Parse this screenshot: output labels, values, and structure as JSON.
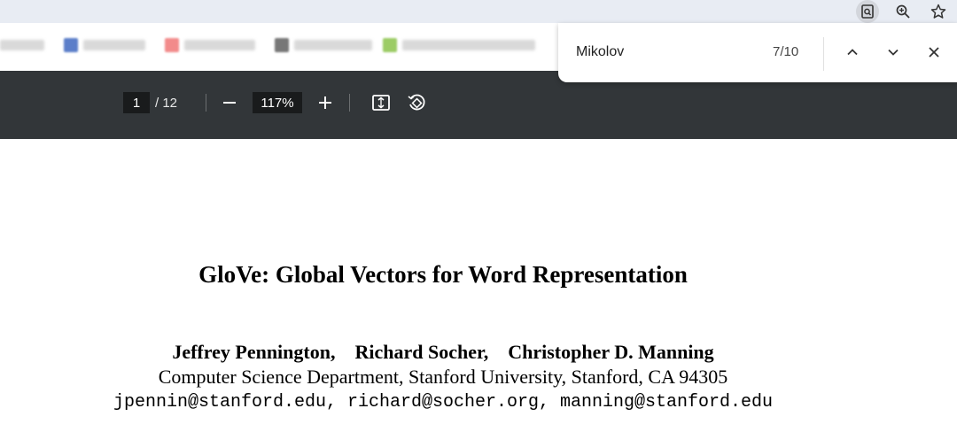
{
  "browser": {
    "icons": [
      "page-search-icon",
      "zoom-icon",
      "star-icon"
    ]
  },
  "bookmarks": [
    {
      "color": "#5b7ec9"
    },
    {
      "color": "#f28b8b"
    },
    {
      "color": "#777777"
    },
    {
      "color": "#9ccc65"
    }
  ],
  "find": {
    "query": "Mikolov",
    "count": "7/10"
  },
  "pdf_toolbar": {
    "page": "1",
    "total": "/ 12",
    "zoom": "117%"
  },
  "document": {
    "title": "GloVe: Global Vectors for Word Representation",
    "authors": "Jeffrey Pennington,    Richard Socher,    Christopher D. Manning",
    "affiliation": "Computer Science Department, Stanford University, Stanford, CA 94305",
    "emails": "jpennin@stanford.edu, richard@socher.org, manning@stanford.edu"
  }
}
